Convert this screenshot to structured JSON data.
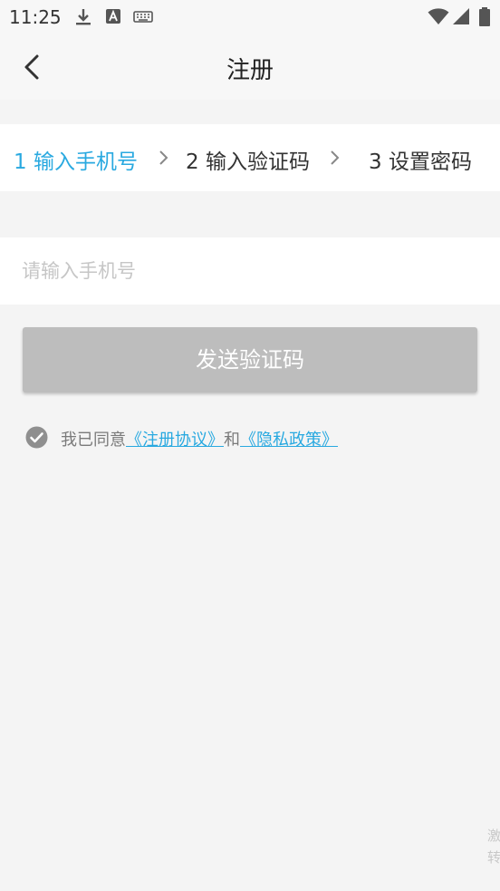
{
  "status_bar": {
    "time": "11:25",
    "icons": [
      "download-icon",
      "font-a-icon",
      "keyboard-icon",
      "wifi-icon",
      "signal-icon",
      "battery-icon"
    ]
  },
  "header": {
    "title": "注册",
    "back_icon": "chevron-left-icon"
  },
  "steps": [
    {
      "label": "1 输入手机号",
      "active": true
    },
    {
      "label": "2 输入验证码",
      "active": false
    },
    {
      "label": "3 设置密码",
      "active": false
    }
  ],
  "phone": {
    "placeholder": "请输入手机号",
    "value": ""
  },
  "send_button": {
    "label": "发送验证码"
  },
  "agreement": {
    "checked": true,
    "prefix": "我已同意",
    "link1": "《注册协议》",
    "middle": "和",
    "link2": "《隐私政策》"
  },
  "watermark": {
    "line1": "激",
    "line2": "转"
  },
  "colors": {
    "accent": "#29a9e0",
    "button_disabled": "#bdbdbd",
    "page_background": "#f4f4f4"
  }
}
